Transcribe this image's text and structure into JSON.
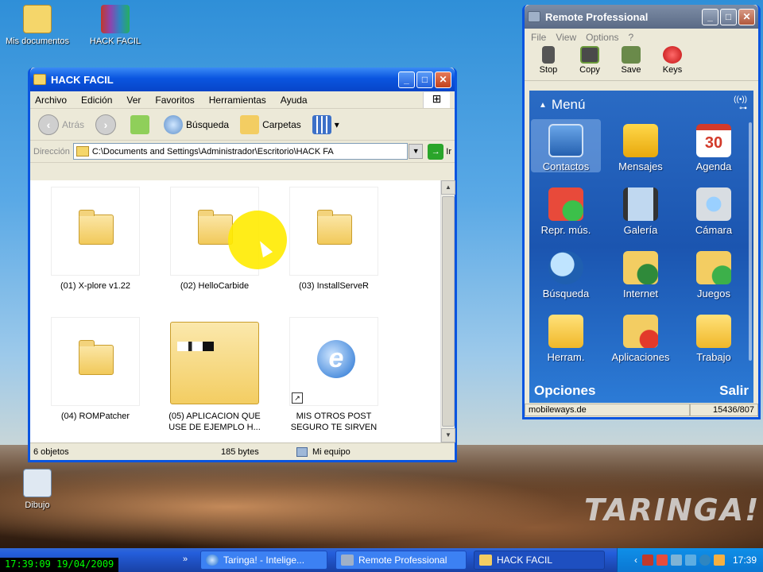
{
  "desktop": {
    "icons": [
      {
        "label": "Mis documentos"
      },
      {
        "label": "HACK FACIL"
      },
      {
        "label": "Dibujo"
      }
    ],
    "watermark": "TARINGA!"
  },
  "explorer": {
    "title": "HACK FACIL",
    "menu": [
      "Archivo",
      "Edición",
      "Ver",
      "Favoritos",
      "Herramientas",
      "Ayuda"
    ],
    "toolbar": {
      "back": "Atrás",
      "search": "Búsqueda",
      "folders": "Carpetas"
    },
    "address": {
      "label": "Dirección",
      "value": "C:\\Documents and Settings\\Administrador\\Escritorio\\HACK FA",
      "go": "Ir"
    },
    "files": [
      {
        "name": "(01) X-plore v1.22",
        "kind": "folder"
      },
      {
        "name": "(02) HelloCarbide",
        "kind": "folder"
      },
      {
        "name": "(03) InstallServeR",
        "kind": "folder"
      },
      {
        "name": "(04) ROMPatcher",
        "kind": "folder"
      },
      {
        "name": "(05) APLICACION QUE USE DE EJEMPLO H...",
        "kind": "folder-thumb"
      },
      {
        "name": "MIS OTROS POST SEGURO TE SIRVEN",
        "kind": "internet-shortcut"
      }
    ],
    "status": {
      "count": "6 objetos",
      "size": "185 bytes",
      "location": "Mi equipo"
    }
  },
  "remote": {
    "title": "Remote Professional",
    "menu": [
      "File",
      "View",
      "Options",
      "?"
    ],
    "tools": [
      "Stop",
      "Copy",
      "Save",
      "Keys"
    ],
    "phone": {
      "header": "Menú",
      "apps": [
        {
          "label": "Contactos"
        },
        {
          "label": "Mensajes"
        },
        {
          "label": "Agenda",
          "badge": "30"
        },
        {
          "label": "Repr. mús."
        },
        {
          "label": "Galería"
        },
        {
          "label": "Cámara"
        },
        {
          "label": "Búsqueda"
        },
        {
          "label": "Internet"
        },
        {
          "label": "Juegos"
        },
        {
          "label": "Herram."
        },
        {
          "label": "Aplicaciones"
        },
        {
          "label": "Trabajo"
        }
      ],
      "soft_left": "Opciones",
      "soft_right": "Salir"
    },
    "status": {
      "left": "mobileways.de",
      "right": "15436/807"
    }
  },
  "taskbar": {
    "osd": "17:39:09 19/04/2009",
    "quicklaunch": "»",
    "tasks": [
      {
        "label": "Taringa! - Intelige..."
      },
      {
        "label": "Remote Professional"
      },
      {
        "label": "HACK FACIL"
      }
    ],
    "clock": "17:39"
  },
  "colors": {
    "xp_blue": "#0a55e0",
    "phone_blue": "#1b55b0",
    "folder_yellow": "#f3cd62"
  }
}
